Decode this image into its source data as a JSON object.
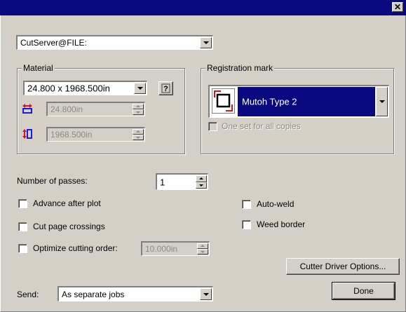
{
  "window": {
    "close_symbol": "✕"
  },
  "device": {
    "selected": "CutServer@FILE:"
  },
  "material": {
    "legend": "Material",
    "size_selected": "24.800 x 1968.500in",
    "help_icon": "question-mark",
    "width_value": "24.800in",
    "height_value": "1968.500in",
    "width_icon": "horizontal-arrows-icon",
    "height_icon": "vertical-arrows-icon"
  },
  "registration": {
    "legend": "Registration mark",
    "selected": "Mutoh Type 2",
    "one_set_label": "One set for all copies"
  },
  "options": {
    "passes_label": "Number of passes:",
    "passes_value": "1",
    "advance_label": "Advance after plot",
    "cut_page_label": "Cut page crossings",
    "optimize_label": "Optimize cutting order:",
    "optimize_value": "10.000in",
    "autoweld_label": "Auto-weld",
    "weed_label": "Weed border"
  },
  "buttons": {
    "driver_options": "Cutter Driver Options...",
    "done": "Done"
  },
  "send": {
    "label": "Send:",
    "selected": "As separate jobs"
  },
  "colors": {
    "titlebar": "#0a0a80",
    "face": "#d4d0c8",
    "accent_red": "#d4141c",
    "accent_blue": "#1c1cd4"
  }
}
